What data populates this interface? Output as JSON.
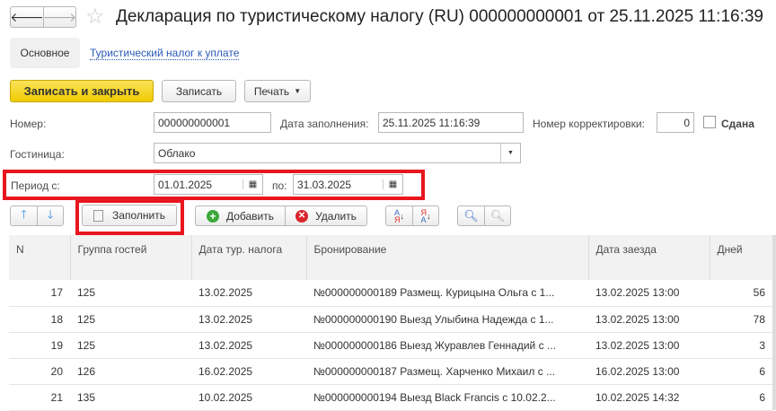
{
  "header": {
    "title": "Декларация по туристическому налогу (RU) 000000000001 от 25.11.2025 11:16:39"
  },
  "tabs": [
    {
      "label": "Основное"
    },
    {
      "label": "Туристический налог к уплате"
    }
  ],
  "toolbar": {
    "save_close": "Записать и закрыть",
    "save": "Записать",
    "print": "Печать"
  },
  "form": {
    "number_label": "Номер:",
    "number_value": "000000000001",
    "date_label": "Дата заполнения:",
    "date_value": "25.11.2025 11:16:39",
    "corr_label": "Номер корректировки:",
    "corr_value": "0",
    "submitted_label": "Сдана",
    "hotel_label": "Гостиница:",
    "hotel_value": "Облако",
    "period_label": "Период с:",
    "period_from": "01.01.2025",
    "period_to_label": "по:",
    "period_to": "31.03.2025"
  },
  "table_toolbar": {
    "fill": "Заполнить",
    "add": "Добавить",
    "delete": "Удалить"
  },
  "table": {
    "columns": [
      "N",
      "Группа гостей",
      "Дата тур. налога",
      "Бронирование",
      "Дата заезда",
      "Дней"
    ],
    "rows": [
      [
        "17",
        "125",
        "13.02.2025",
        "№000000000189 Размещ. Курицына Ольга с 1...",
        "13.02.2025 13:00",
        "56"
      ],
      [
        "18",
        "125",
        "13.02.2025",
        "№000000000190 Выезд Улыбина Надежда с 1...",
        "13.02.2025 13:00",
        "78"
      ],
      [
        "19",
        "125",
        "13.02.2025",
        "№000000000186 Выезд Журавлев Геннадий с ...",
        "13.02.2025 13:00",
        "3"
      ],
      [
        "20",
        "126",
        "16.02.2025",
        "№000000000187 Размещ. Харченко Михаил с ...",
        "16.02.2025 13:00",
        "6"
      ],
      [
        "21",
        "135",
        "10.02.2025",
        "№000000000194 Выезд Black Francis с 10.02.2...",
        "10.02.2025 14:32",
        "6"
      ]
    ]
  }
}
